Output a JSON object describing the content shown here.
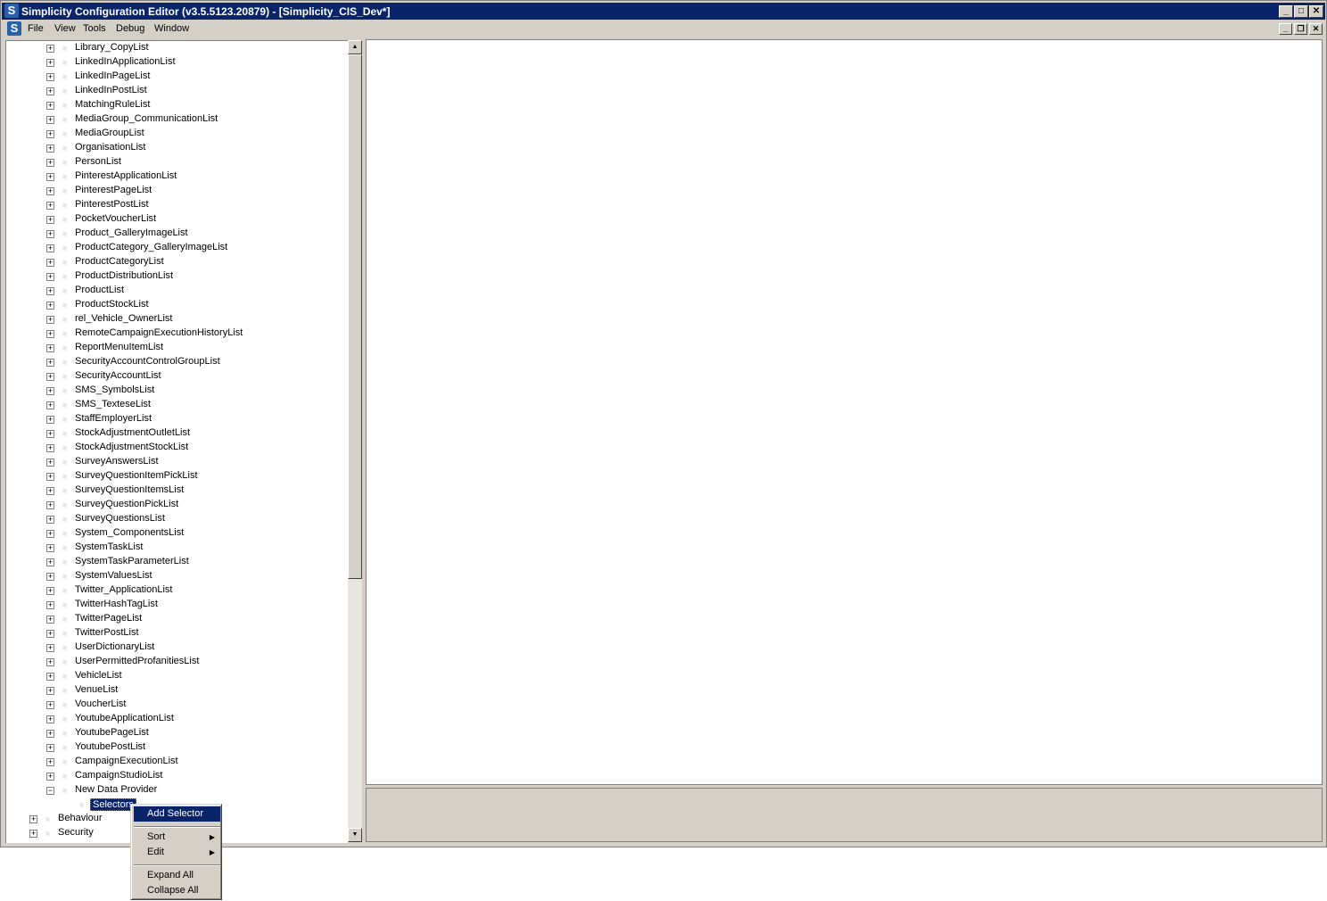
{
  "window": {
    "title": "Simplicity Configuration Editor (v3.5.5123.20879) - [Simplicity_CIS_Dev*]",
    "app_icon_letter": "S",
    "controls": {
      "minimize": "_",
      "maximize": "□",
      "close": "✕"
    },
    "mdi_controls": {
      "minimize": "_",
      "restore": "❐",
      "close": "✕"
    }
  },
  "menubar": {
    "items": [
      "File",
      "View",
      "Tools",
      "Debug",
      "Window"
    ]
  },
  "tree": {
    "lists": [
      "Library_CopyList",
      "LinkedInApplicationList",
      "LinkedInPageList",
      "LinkedInPostList",
      "MatchingRuleList",
      "MediaGroup_CommunicationList",
      "MediaGroupList",
      "OrganisationList",
      "PersonList",
      "PinterestApplicationList",
      "PinterestPageList",
      "PinterestPostList",
      "PocketVoucherList",
      "Product_GalleryImageList",
      "ProductCategory_GalleryImageList",
      "ProductCategoryList",
      "ProductDistributionList",
      "ProductList",
      "ProductStockList",
      "rel_Vehicle_OwnerList",
      "RemoteCampaignExecutionHistoryList",
      "ReportMenuItemList",
      "SecurityAccountControlGroupList",
      "SecurityAccountList",
      "SMS_SymbolsList",
      "SMS_TexteseList",
      "StaffEmployerList",
      "StockAdjustmentOutletList",
      "StockAdjustmentStockList",
      "SurveyAnswersList",
      "SurveyQuestionItemPickList",
      "SurveyQuestionItemsList",
      "SurveyQuestionPickList",
      "SurveyQuestionsList",
      "System_ComponentsList",
      "SystemTaskList",
      "SystemTaskParameterList",
      "SystemValuesList",
      "Twitter_ApplicationList",
      "TwitterHashTagList",
      "TwitterPageList",
      "TwitterPostList",
      "UserDictionaryList",
      "UserPermittedProfanitiesList",
      "VehicleList",
      "VenueList",
      "VoucherList",
      "YoutubeApplicationList",
      "YoutubePageList",
      "YoutubePostList",
      "CampaignExecutionList",
      "CampaignStudioList"
    ],
    "new_provider": "New Data Provider",
    "selected_child": "Selectors",
    "root_nodes": [
      "Behaviour",
      "Security"
    ],
    "expander_plus": "+",
    "expander_minus": "−"
  },
  "context_menu": {
    "items": [
      "Add Selector",
      "Sort",
      "Edit",
      "Expand All",
      "Collapse All"
    ],
    "submenu_arrow": "▶"
  },
  "scrollbar": {
    "up_arrow": "▲",
    "down_arrow": "▼"
  }
}
